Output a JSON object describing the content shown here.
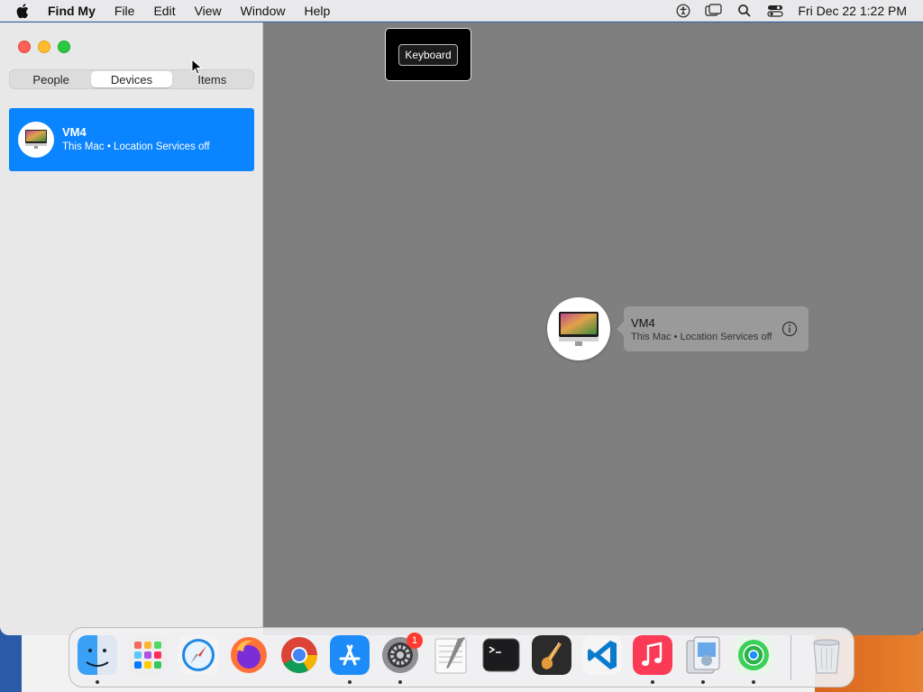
{
  "menubar": {
    "app_name": "Find My",
    "menus": [
      "File",
      "Edit",
      "View",
      "Window",
      "Help"
    ],
    "clock": "Fri Dec 22  1:22 PM",
    "status_icons": [
      "accessibility-icon",
      "screen-mirroring-icon",
      "spotlight-search-icon",
      "control-center-icon"
    ]
  },
  "sidebar": {
    "tabs": [
      "People",
      "Devices",
      "Items"
    ],
    "active_tab": "Devices",
    "devices": [
      {
        "name": "VM4",
        "subtitle": "This Mac • Location Services off"
      }
    ]
  },
  "keyboard_popup": {
    "label": "Keyboard"
  },
  "map": {
    "callout": {
      "name": "VM4",
      "subtitle": "This Mac • Location Services off"
    }
  },
  "dock": {
    "apps": [
      "Finder",
      "Launchpad",
      "Safari",
      "Firefox",
      "Chrome",
      "App Store",
      "System Settings",
      "TextEdit",
      "Terminal",
      "GarageBand",
      "Visual Studio Code",
      "Music",
      "Preview",
      "Find My",
      "Trash"
    ],
    "system_settings_badge": "1"
  },
  "colors": {
    "accent": "#0a84ff",
    "map_bg": "#7f7f7f",
    "sidebar_bg": "#e8e8e8"
  }
}
